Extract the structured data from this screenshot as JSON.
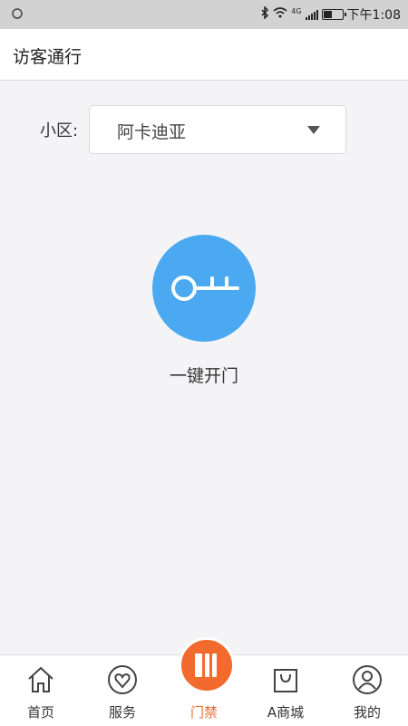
{
  "status_bar": {
    "time": "下午1:08",
    "network": "4G"
  },
  "header": {
    "title": "访客通行"
  },
  "community": {
    "label": "小区:",
    "selected": "阿卡迪亚"
  },
  "unlock": {
    "label": "一键开门"
  },
  "tabs": [
    {
      "label": "首页",
      "icon": "home-icon"
    },
    {
      "label": "服务",
      "icon": "heart-icon"
    },
    {
      "label": "门禁",
      "icon": "door-icon",
      "active": true
    },
    {
      "label": "A商城",
      "icon": "shopping-bag-icon"
    },
    {
      "label": "我的",
      "icon": "user-icon"
    }
  ],
  "colors": {
    "accent": "#f26a2e",
    "unlock_blue": "#4aa9f0"
  }
}
